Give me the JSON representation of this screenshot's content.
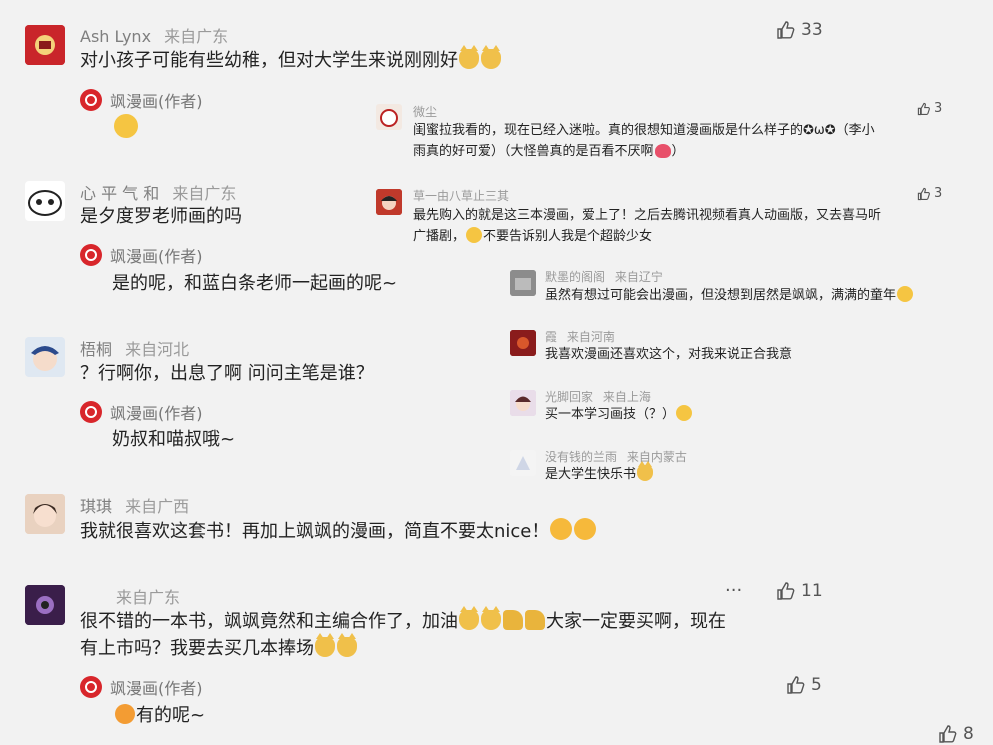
{
  "comments": [
    {
      "nick": "Ash Lynx",
      "location": "来自广东",
      "text": "对小孩子可能有些幼稚，但对大学生来说刚刚好",
      "likes": "33"
    },
    {
      "nick": "心 平 气 和",
      "location": "来自广东",
      "text": "是夕度罗老师画的吗"
    },
    {
      "nick": "梧桐",
      "location": "来自河北",
      "text": "？行啊你，出息了啊 问问主笔是谁？"
    },
    {
      "nick": "琪琪",
      "location": "来自广西",
      "text": "我就很喜欢这套书！再加上飒飒的漫画，简直不要太nice！"
    },
    {
      "nick": "",
      "location": "来自广东",
      "text_line1": "很不错的一本书，飒飒竟然和主编合作了，加油",
      "text_line1b": "大家一定要买啊，现在",
      "text_line2": "有上市吗？我要去买几本捧场",
      "likes": "11",
      "more": "···"
    }
  ],
  "author_replies": [
    {
      "author": "飒漫画(作者)",
      "text": ""
    },
    {
      "author": "飒漫画(作者)",
      "text": "是的呢，和蓝白条老师一起画的呢~"
    },
    {
      "author": "飒漫画(作者)",
      "text": "奶叔和喵叔哦~"
    },
    {
      "author": "飒漫画(作者)",
      "text": "有的呢~",
      "likes": "5"
    }
  ],
  "bottom_likes": "8",
  "side_comments": [
    {
      "nick": "微尘",
      "text_line1": "闺蜜拉我看的，现在已经入迷啦。真的很想知道漫画版是什么样子的✪ω✪（李小",
      "text_line2": "雨真的好可爱）（大怪兽真的是百看不厌啊",
      "likes": "3"
    },
    {
      "nick": "草一由八草止三其",
      "text_line1": "最先购入的就是这三本漫画，爱上了！之后去腾讯视频看真人动画版，又去喜马听",
      "text_line2": "广播剧，",
      "text_line2b": "不要告诉别人我是个超龄少女",
      "likes": "3"
    },
    {
      "nick": "默墨的阁阁",
      "location": "来自辽宁",
      "text": "虽然有想过可能会出漫画，但没想到居然是飒飒，满满的童年"
    },
    {
      "nick": "霞",
      "location": "来自河南",
      "text": "我喜欢漫画还喜欢这个，对我来说正合我意"
    },
    {
      "nick": "光脚回家",
      "location": "来自上海",
      "text": "买一本学习画技（？）"
    },
    {
      "nick": "没有钱的兰雨",
      "location": "来自内蒙古",
      "text": "是大学生快乐书"
    }
  ],
  "icons": {
    "like": "thumbs-up-icon",
    "author_logo": "weibo-author-icon"
  }
}
